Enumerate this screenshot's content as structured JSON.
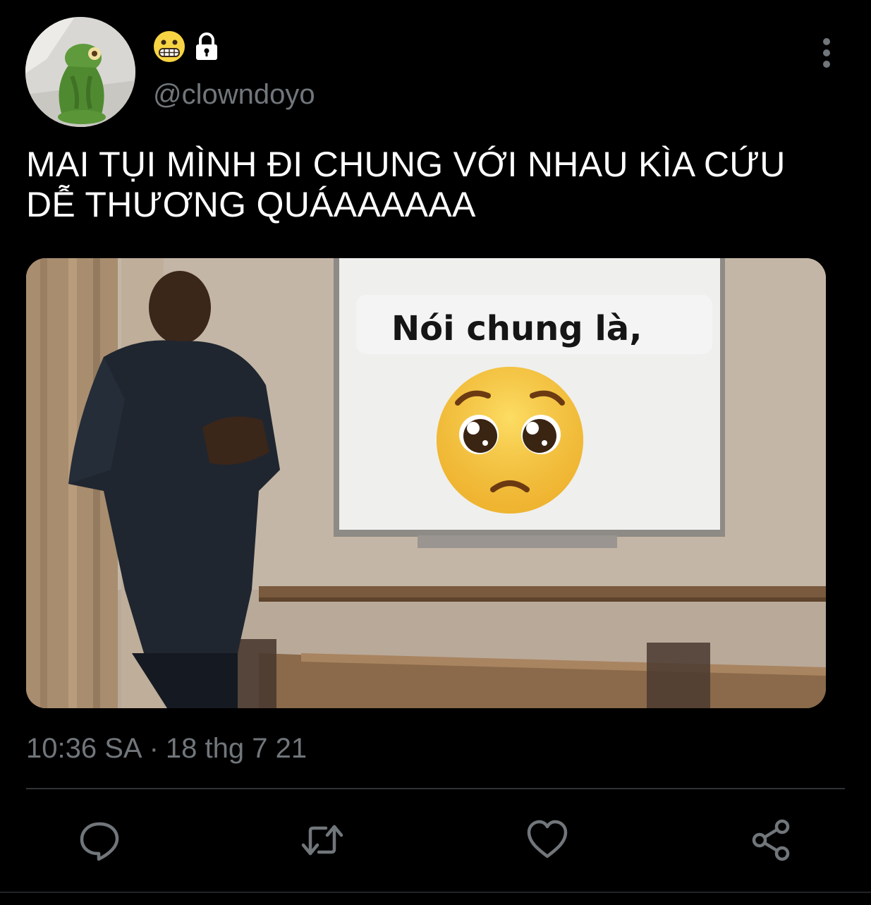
{
  "author": {
    "display_name_icons": [
      "grimacing-face-emoji",
      "lock-icon"
    ],
    "handle": "@clowndoyo"
  },
  "tweet": {
    "text": "MAI TỤI MÌNH ĐI CHUNG VỚI NHAU KÌA CỨU\nDỄ THƯƠNG QUÁAAAAAA",
    "media": {
      "caption": "Nói chung là,",
      "emoji": "pleading-face-emoji"
    },
    "time": "10:36 SA",
    "separator": "·",
    "date": "18 thg 7 21"
  },
  "actions": [
    "reply-icon",
    "retweet-icon",
    "like-icon",
    "share-icon"
  ],
  "colors": {
    "background": "#000000",
    "text": "#ffffff",
    "secondary": "#71767b",
    "divider": "#2f3336"
  }
}
